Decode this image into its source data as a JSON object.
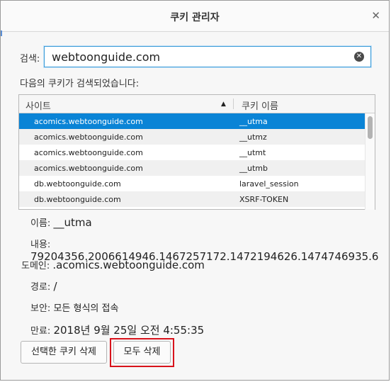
{
  "dialog": {
    "title": "쿠키 관리자"
  },
  "search": {
    "label": "검색:",
    "value": "webtoonguide.com"
  },
  "result_text": "다음의 쿠키가 검색되었습니다:",
  "table": {
    "columns": [
      "사이트",
      "쿠키 이름"
    ],
    "sort_indicator": "▲",
    "rows": [
      {
        "site": "acomics.webtoonguide.com",
        "name": "__utma"
      },
      {
        "site": "acomics.webtoonguide.com",
        "name": "__utmz"
      },
      {
        "site": "acomics.webtoonguide.com",
        "name": "__utmt"
      },
      {
        "site": "acomics.webtoonguide.com",
        "name": "__utmb"
      },
      {
        "site": "db.webtoonguide.com",
        "name": "laravel_session"
      },
      {
        "site": "db.webtoonguide.com",
        "name": "XSRF-TOKEN"
      }
    ]
  },
  "details": {
    "name": {
      "label": "이름:",
      "value": "__utma"
    },
    "content": {
      "label": "내용:",
      "value": "79204356.2006614946.1467257172.1472194626.1474746935.6"
    },
    "domain": {
      "label": "도메인:",
      "value": ".acomics.webtoonguide.com"
    },
    "path": {
      "label": "경로:",
      "value": "/"
    },
    "security": {
      "label": "보안:",
      "value": "모든 형식의 접속"
    },
    "expires": {
      "label": "만료:",
      "value": "2018년 9월 25일 오전 4:55:35"
    }
  },
  "buttons": {
    "delete_selected": "선택한 쿠키 삭제",
    "delete_all": "모두 삭제"
  }
}
